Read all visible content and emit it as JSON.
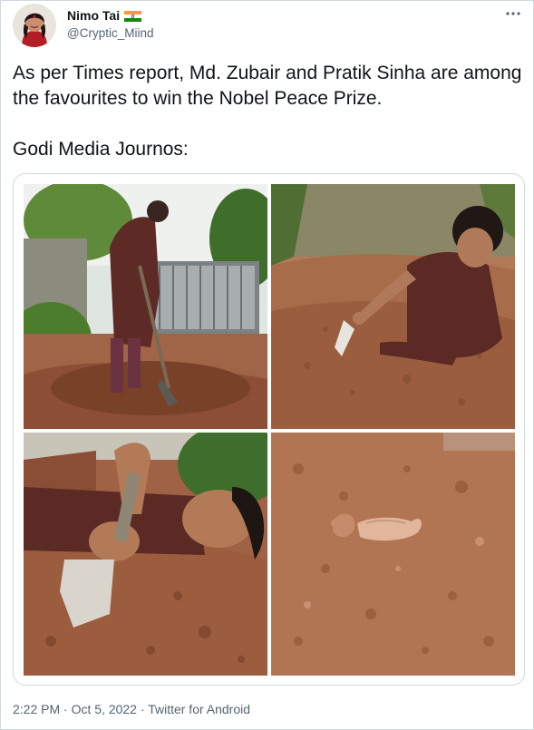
{
  "user": {
    "display_name": "Nimo Tai",
    "handle": "@Cryptic_Miind",
    "badge": "india-flag-icon"
  },
  "tweet": {
    "line1": "As per Times report, Md. Zubair and Pratik Sinha are among the favourites to win the Nobel Peace Prize.",
    "line2": "Godi Media Journos:"
  },
  "media": {
    "photos": [
      {
        "subject": "woman-digging-with-shovel"
      },
      {
        "subject": "woman-buried-in-soil-with-trowel"
      },
      {
        "subject": "woman-lying-in-soil-holding-trowel"
      },
      {
        "subject": "hand-emerging-from-soil"
      }
    ]
  },
  "meta": {
    "time": "2:22 PM",
    "sep1": " · ",
    "date": "Oct 5, 2022",
    "sep2": " · ",
    "client": "Twitter for Android"
  },
  "colors": {
    "text": "#0f1419",
    "secondary": "#536471",
    "border": "#cfd9de",
    "soil": "#9c5a3a",
    "shirt": "#5b2a24"
  }
}
